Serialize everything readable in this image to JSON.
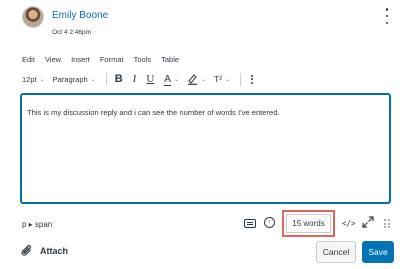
{
  "post": {
    "author": "Emily Boone",
    "date": "Oct 4 2:46pm"
  },
  "menubar": [
    "Edit",
    "View",
    "Insert",
    "Format",
    "Tools",
    "Table"
  ],
  "toolbar": {
    "font_size": "12pt",
    "block_format": "Paragraph",
    "bold": "B",
    "italic": "I",
    "underline": "U",
    "text_color": "A",
    "superscript": "T²"
  },
  "editor": {
    "content": "This is my discussion reply and i can see the number of words I've entered."
  },
  "statusbar": {
    "path": "p ▸ span",
    "word_count": "15 words",
    "html_editor": "</>"
  },
  "footer": {
    "attach_label": "Attach",
    "cancel_label": "Cancel",
    "save_label": "Save"
  },
  "colors": {
    "link": "#0770a3",
    "editor_border": "#0770a3",
    "highlight": "#e0655a",
    "primary_button": "#0374b5"
  }
}
